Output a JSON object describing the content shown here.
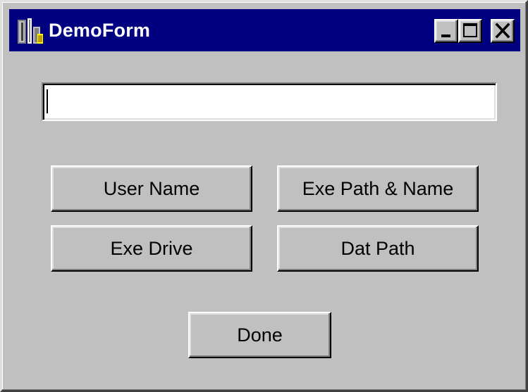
{
  "window": {
    "title": "DemoForm",
    "icon": "app-icon",
    "colors": {
      "titlebar": "#000080",
      "face": "#c0c0c0",
      "title_text": "#ffffff"
    }
  },
  "caption_buttons": {
    "minimize_icon": "minimize-icon",
    "maximize_icon": "maximize-icon",
    "close_icon": "close-icon"
  },
  "input": {
    "value": "",
    "placeholder": ""
  },
  "buttons": {
    "user_name": "User Name",
    "exe_path_name": "Exe Path & Name",
    "exe_drive": "Exe Drive",
    "dat_path": "Dat Path",
    "done": "Done"
  }
}
